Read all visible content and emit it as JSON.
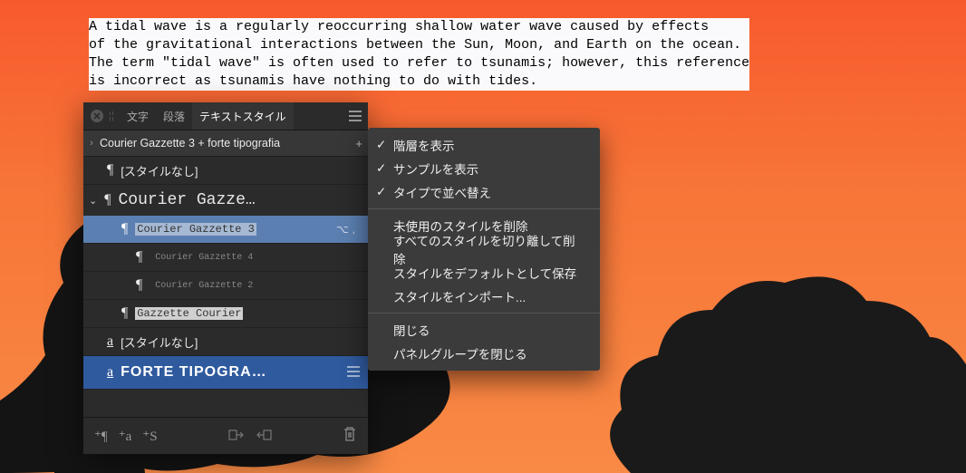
{
  "document": {
    "line1": "A tidal wave is a regularly reoccurring shallow water wave caused by effects",
    "line2": "of the gravitational interactions between the Sun, Moon, and Earth on the ocean.",
    "line3": "The term \"tidal wave\" is often used to refer to tsunamis; however, this reference",
    "line4": "is incorrect as tsunamis have nothing to do with tides."
  },
  "panel": {
    "tabs": {
      "char": "文字",
      "para": "段落",
      "styles": "テキストスタイル"
    },
    "breadcrumb": "Courier Gazzette 3 + forte tipografia",
    "breadcrumb_plus": "+",
    "rows": {
      "none1": "[スタイルなし]",
      "group": "Courier Gazze…",
      "sel": "Courier Gazzette 3",
      "sel_icons": "⌥,",
      "sub4": "Courier Gazzette 4",
      "sub2": "Courier Gazzette 2",
      "gazcour": "Gazzette Courier",
      "none2": "[スタイルなし]",
      "forte": "FORTE TIPOGRA…"
    },
    "footer": {
      "b1": "⁺¶",
      "b2": "⁺a",
      "b3": "⁺S"
    }
  },
  "menu": {
    "show_hierarchy": "階層を表示",
    "show_sample": "サンプルを表示",
    "sort_by_type": "タイプで並べ替え",
    "delete_unused": "未使用のスタイルを削除",
    "detach_delete": "すべてのスタイルを切り離して削除",
    "save_default": "スタイルをデフォルトとして保存",
    "import": "スタイルをインポート...",
    "close": "閉じる",
    "close_group": "パネルグループを閉じる"
  }
}
